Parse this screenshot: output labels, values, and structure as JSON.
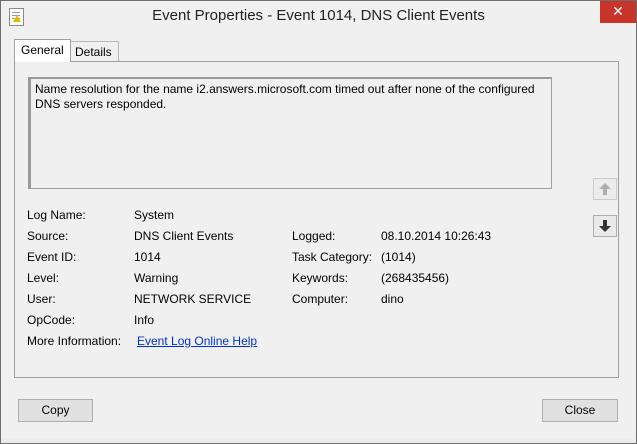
{
  "window": {
    "title": "Event Properties - Event 1014, DNS Client Events",
    "close_label": "✕"
  },
  "tabs": [
    {
      "label": "General"
    },
    {
      "label": "Details"
    }
  ],
  "general": {
    "message": "Name resolution for the name i2.answers.microsoft.com timed out after none of the configured DNS servers responded.",
    "fields": {
      "log_name": {
        "label": "Log Name:",
        "value": "System"
      },
      "source": {
        "label": "Source:",
        "value": "DNS Client Events"
      },
      "logged": {
        "label": "Logged:",
        "value": "08.10.2014 10:26:43"
      },
      "event_id": {
        "label": "Event ID:",
        "value": "1014"
      },
      "task_category": {
        "label": "Task Category:",
        "value": "(1014)"
      },
      "level": {
        "label": "Level:",
        "value": "Warning"
      },
      "keywords": {
        "label": "Keywords:",
        "value": "(268435456)"
      },
      "user": {
        "label": "User:",
        "value": "NETWORK SERVICE"
      },
      "computer": {
        "label": "Computer:",
        "value": "dino"
      },
      "opcode": {
        "label": "OpCode:",
        "value": "Info"
      },
      "more_info": {
        "label": "More Information:",
        "value": "Event Log Online Help"
      }
    }
  },
  "nav": {
    "up_icon": "arrow-up-icon",
    "down_icon": "arrow-down-icon"
  },
  "buttons": {
    "copy": "Copy",
    "close": "Close"
  }
}
